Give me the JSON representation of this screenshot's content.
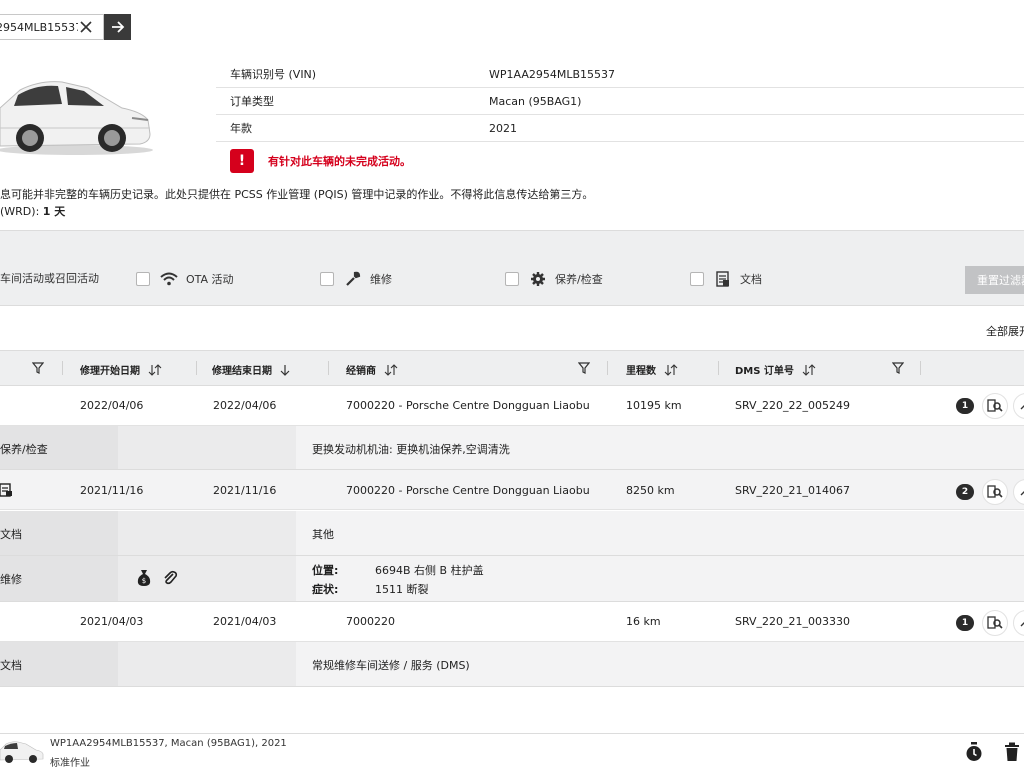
{
  "search": {
    "value": "2954MLB15537"
  },
  "vehicle": {
    "rows": [
      {
        "label": "车辆识别号 (VIN)",
        "value": "WP1AA2954MLB15537"
      },
      {
        "label": "订单类型",
        "value": "Macan (95BAG1)"
      },
      {
        "label": "年款",
        "value": "2021"
      }
    ],
    "alert": "有针对此车辆的未完成活动。"
  },
  "disclaimer": "息可能并非完整的车辆历史记录。此处只提供在 PCSS 作业管理 (PQIS) 管理中记录的作业。不得将此信息传达给第三方。",
  "wrd": {
    "label": "(WRD): ",
    "value": "1 天"
  },
  "filters": {
    "items": [
      {
        "label": "车间活动或召回活动",
        "icon": "campaign-icon"
      },
      {
        "label": "OTA 活动",
        "icon": "wifi-icon"
      },
      {
        "label": "维修",
        "icon": "wrench-icon"
      },
      {
        "label": "保养/检查",
        "icon": "gear-icon"
      },
      {
        "label": "文档",
        "icon": "document-icon"
      }
    ],
    "reset": "重置过滤器",
    "expand_all": "全部展开"
  },
  "table": {
    "headers": {
      "start": "修理开始日期",
      "end": "修理结束日期",
      "dealer": "经销商",
      "mileage": "里程数",
      "dms": "DMS 订单号"
    },
    "rows": [
      {
        "start": "2022/04/06",
        "end": "2022/04/06",
        "dealer": "7000220 - Porsche Centre Dongguan Liaobu",
        "mileage": "10195 km",
        "dms": "SRV_220_22_005249",
        "count": "1",
        "subs": [
          {
            "category": "保养/检查",
            "text": "更换发动机机油: 更换机油保养,空调清洗"
          }
        ]
      },
      {
        "start": "2021/11/16",
        "end": "2021/11/16",
        "dealer": "7000220 - Porsche Centre Dongguan Liaobu",
        "mileage": "8250 km",
        "dms": "SRV_220_21_014067",
        "count": "2",
        "subs": [
          {
            "category": "文档",
            "text": "其他"
          },
          {
            "category": "维修",
            "position_label": "位置:",
            "position_value": "6694B 右侧 B 柱护盖",
            "symptom_label": "症状:",
            "symptom_value": "1511 断裂"
          }
        ]
      },
      {
        "start": "2021/04/03",
        "end": "2021/04/03",
        "dealer": "7000220",
        "mileage": "16 km",
        "dms": "SRV_220_21_003330",
        "count": "1",
        "subs": [
          {
            "category": "文档",
            "text": "常规维修车间送修 / 服务 (DMS)"
          }
        ]
      }
    ]
  },
  "footer": {
    "line1": "WP1AA2954MLB15537, Macan (95BAG1), 2021",
    "line2": "标准作业"
  },
  "colors": {
    "alert": "#d5001c",
    "dark": "#2b2b2b",
    "panel": "#eeeff0"
  }
}
